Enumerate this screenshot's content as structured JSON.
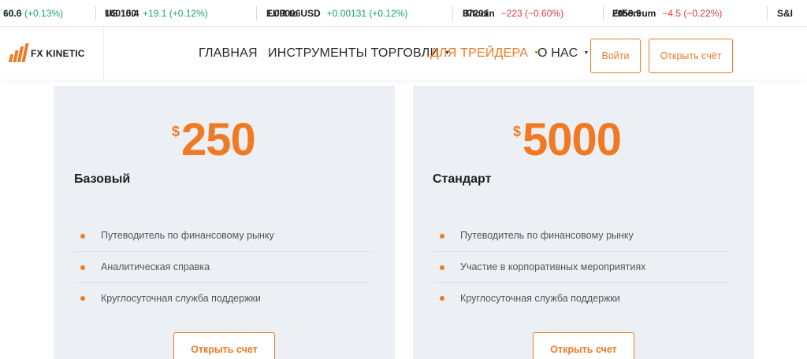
{
  "ticker": [
    {
      "symbol": "",
      "price": "60.6",
      "change": "+6.0 (+0.13%)",
      "dir": "up"
    },
    {
      "symbol": "US 100",
      "price": "16015.4",
      "change": "+19.1 (+0.12%)",
      "dir": "up"
    },
    {
      "symbol": "EUR to USD",
      "price": "1.09006",
      "change": "+0.00131 (+0.12%)",
      "dir": "up"
    },
    {
      "symbol": "Bitcoin",
      "price": "37201",
      "change": "−223 (−0.60%)",
      "dir": "down"
    },
    {
      "symbol": "Ethereum",
      "price": "2059.9",
      "change": "−4.5 (−0.22%)",
      "dir": "down"
    },
    {
      "symbol": "S&I",
      "price": "",
      "change": "",
      "dir": "up"
    }
  ],
  "header": {
    "logo_text": "FX KINETIC",
    "nav": [
      {
        "label": "ГЛАВНАЯ",
        "dropdown": false,
        "active": false
      },
      {
        "label": "ИНСТРУМЕНТЫ ТОРГОВЛИ",
        "dropdown": true,
        "active": false
      },
      {
        "label": "ДЛЯ ТРЕЙДЕРА",
        "dropdown": true,
        "active": true
      },
      {
        "label": "О НАС",
        "dropdown": true,
        "active": false
      }
    ],
    "login_label": "Войти",
    "open_account_label": "Открыть счёт"
  },
  "plans": [
    {
      "currency": "$",
      "amount": "250",
      "name": "Базовый",
      "features": [
        "Путеводитель по финансовому рынку",
        "Аналитическая справка",
        "Круглосуточная служба поддержки"
      ],
      "button_label": "Открыть счет"
    },
    {
      "currency": "$",
      "amount": "5000",
      "name": "Стандарт",
      "features": [
        "Путеводитель по финансовому рынку",
        "Участие в корпоративных мероприятиях",
        "Круглосуточная служба поддержки"
      ],
      "button_label": "Открыть счет"
    }
  ],
  "colors": {
    "accent": "#f07a24",
    "up": "#1aa36b",
    "down": "#e0393e",
    "card_bg": "#eceff3"
  }
}
